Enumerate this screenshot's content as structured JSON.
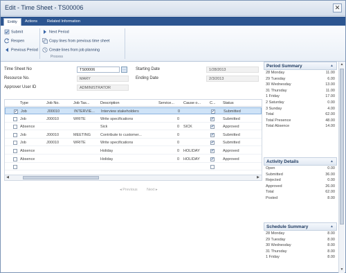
{
  "window": {
    "title": "Edit - Time Sheet - TS00006",
    "close_symbol": "✕"
  },
  "tabs": [
    {
      "label": "Entity",
      "active": true
    },
    {
      "label": "Actions",
      "active": false
    },
    {
      "label": "Related Information",
      "active": false
    }
  ],
  "ribbon": {
    "buttons": {
      "submit": "Submit",
      "reopen": "Reopen",
      "previous_period": "Previous Period",
      "next_period": "Next Period",
      "copy_lines": "Copy lines from previous time sheet",
      "create_lines": "Create lines from job planning"
    },
    "group_label": "Process"
  },
  "form": {
    "time_sheet_no": {
      "label": "Time Sheet No",
      "value": "TS00006",
      "lookup_symbol": "…"
    },
    "resource_no": {
      "label": "Resource No.",
      "value": "MARY"
    },
    "approver": {
      "label": "Approver User ID",
      "value": "ADMINISTRATOR"
    },
    "starting_date": {
      "label": "Starting Date",
      "value": "1/28/2013"
    },
    "ending_date": {
      "label": "Ending Date",
      "value": "2/3/2013"
    }
  },
  "grid": {
    "columns": [
      "Type",
      "Job No.",
      "Job Tas...",
      "Description",
      "Service...",
      "Cause o...",
      "C...",
      "Status"
    ],
    "rows": [
      {
        "check": true,
        "type": "Job",
        "job_no": "J00010",
        "job_task": "INTERVIE...",
        "description": "Interview stakeholders",
        "service": "0",
        "cause": "",
        "c": true,
        "status": "Submitted",
        "selected": true
      },
      {
        "check": false,
        "type": "Job",
        "job_no": "J00010",
        "job_task": "WRITE",
        "description": "Write specifications",
        "service": "0",
        "cause": "",
        "c": true,
        "status": "Submitted",
        "selected": false
      },
      {
        "check": false,
        "type": "Absence",
        "job_no": "",
        "job_task": "",
        "description": "Sick",
        "service": "0",
        "cause": "SICK",
        "c": true,
        "status": "Approved",
        "selected": false
      },
      {
        "check": false,
        "type": "Job",
        "job_no": "J00010",
        "job_task": "MEETING",
        "description": "Contribute to customer...",
        "service": "0",
        "cause": "",
        "c": true,
        "status": "Submitted",
        "selected": false
      },
      {
        "check": false,
        "type": "Job",
        "job_no": "J00010",
        "job_task": "WRITE",
        "description": "Write specifications",
        "service": "0",
        "cause": "",
        "c": true,
        "status": "Submitted",
        "selected": false
      },
      {
        "check": false,
        "type": "Absence",
        "job_no": "",
        "job_task": "",
        "description": "Holiday",
        "service": "0",
        "cause": "HOLIDAY",
        "c": true,
        "status": "Approved",
        "selected": false
      },
      {
        "check": false,
        "type": "Absence",
        "job_no": "",
        "job_task": "",
        "description": "Holiday",
        "service": "0",
        "cause": "HOLIDAY",
        "c": true,
        "status": "Approved",
        "selected": false
      },
      {
        "check": false,
        "type": "",
        "job_no": "",
        "job_task": "",
        "description": "",
        "service": "",
        "cause": "",
        "c": false,
        "status": "",
        "selected": false
      }
    ],
    "check_symbol": "✔",
    "scroll_left": "◀",
    "scroll_right": "▶"
  },
  "pager": {
    "previous": "◂ Previous",
    "next": "Next ▸"
  },
  "period_summary": {
    "title": "Period Summary",
    "rows": [
      {
        "k": "28 Monday",
        "v": "11.00"
      },
      {
        "k": "29 Tuesday",
        "v": "6.00"
      },
      {
        "k": "30 Wednesday",
        "v": "13.00"
      },
      {
        "k": "31 Thursday",
        "v": "11.00"
      },
      {
        "k": "1 Friday",
        "v": "17.00"
      },
      {
        "k": "2 Saturday",
        "v": "0.00"
      },
      {
        "k": "3 Sunday",
        "v": "4.00"
      },
      {
        "k": "Total",
        "v": "62.00"
      },
      {
        "k": "Total Presence",
        "v": "48.00"
      },
      {
        "k": "Total Absence",
        "v": "14.00"
      }
    ]
  },
  "activity_details": {
    "title": "Activity Details",
    "rows": [
      {
        "k": "Open",
        "v": "0.00"
      },
      {
        "k": "Submitted",
        "v": "36.00"
      },
      {
        "k": "Rejected",
        "v": "0.00"
      },
      {
        "k": "Approved",
        "v": "26.00"
      },
      {
        "k": "Total",
        "v": "62.00"
      },
      {
        "k": "Posted",
        "v": "8.00"
      }
    ]
  },
  "schedule_summary": {
    "title": "Schedule Summary",
    "rows": [
      {
        "k": "28 Monday",
        "v": "8.00"
      },
      {
        "k": "29 Tuesday",
        "v": "8.00"
      },
      {
        "k": "30 Wednesday",
        "v": "8.00"
      },
      {
        "k": "31 Thursday",
        "v": "8.00"
      },
      {
        "k": "1 Friday",
        "v": "8.00"
      }
    ]
  },
  "panel_caret": "▲",
  "vscroll": {
    "up": "▲",
    "down": "▼"
  },
  "colors": {
    "accent": "#2c5590",
    "selection": "#cfe3f7"
  }
}
